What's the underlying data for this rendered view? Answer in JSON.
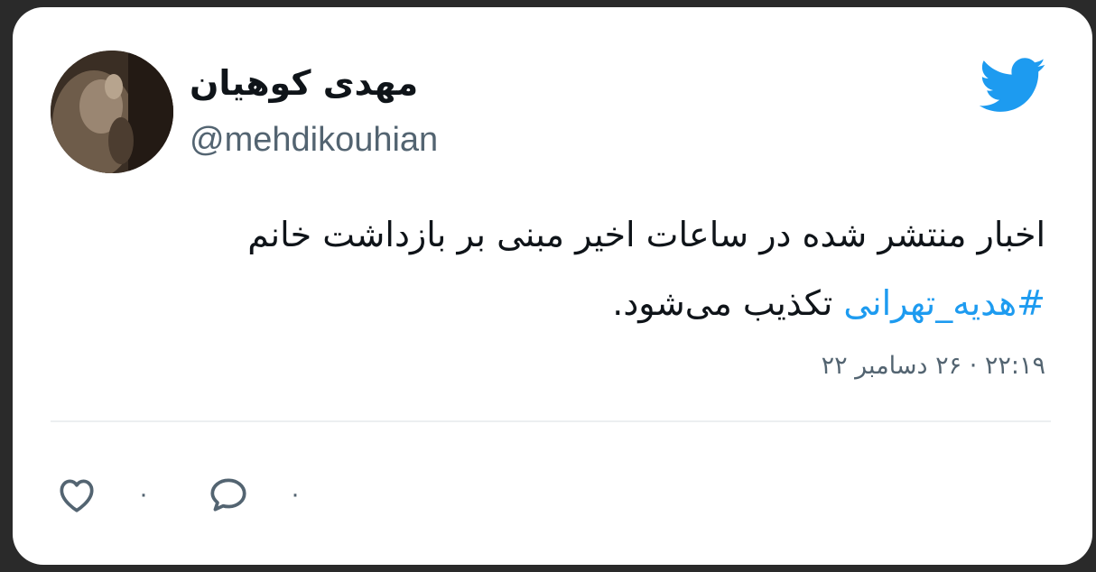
{
  "tweet": {
    "display_name": "مهدی کوهیان",
    "handle": "@mehdikouhian",
    "text_part1": "اخبار منتشر شده در ساعات اخیر مبنی بر بازداشت خانم ",
    "hashtag": "#هدیه_تهرانی",
    "text_part2": " تکذیب می‌شود.",
    "timestamp": "۲۲:۱۹ · ۲۶ دسامبر ۲۲"
  },
  "actions": {
    "like_count": "۰",
    "reply_count": "۰"
  },
  "icons": {
    "brand": "twitter-bird-icon",
    "like": "heart-icon",
    "reply": "speech-bubble-icon"
  },
  "colors": {
    "brand_blue": "#1d9bf0",
    "text": "#0f1419",
    "secondary_text": "#536471",
    "card_background": "#ffffff"
  }
}
